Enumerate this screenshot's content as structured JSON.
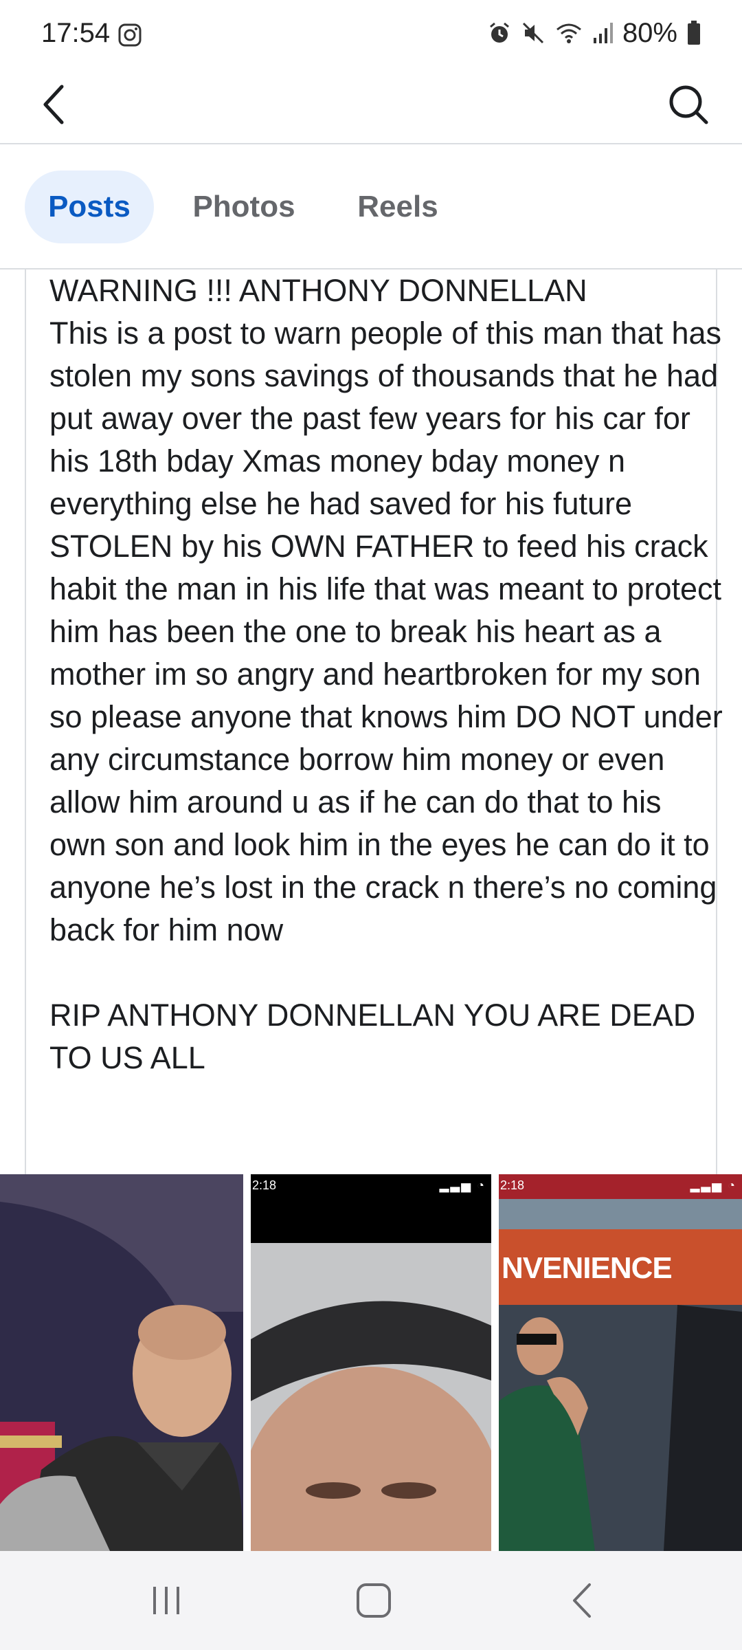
{
  "status_bar": {
    "time": "17:54",
    "battery": "80%",
    "icons": [
      "instagram-icon",
      "alarm-icon",
      "mute-icon",
      "wifi-icon",
      "signal-icon",
      "battery-icon"
    ]
  },
  "app_bar": {
    "back_icon": "back-arrow-icon",
    "search_icon": "search-icon"
  },
  "tabs": [
    {
      "label": "Posts",
      "active": true
    },
    {
      "label": "Photos",
      "active": false
    },
    {
      "label": "Reels",
      "active": false
    }
  ],
  "post": {
    "text": "WARNING !!! ANTHONY DONNELLAN\nThis is a post to warn people of this man that has stolen my sons savings of thousands that he had put away over the past few years for his car for his 18th bday Xmas money bday money n everything else he had saved for his future STOLEN by his OWN FATHER to feed his crack habit the man in his life that was meant to protect him has been the one to break his heart as a mother im so angry and heartbroken for my son so please anyone that knows him DO NOT under any circumstance borrow him money or even allow him around u as if he can do that to his own son and look him in the eyes he can do it to anyone he’s lost in the crack n there’s no coming back for him now\n\nRIP ANTHONY DONNELLAN YOU ARE DEAD TO US ALL",
    "photos": [
      {
        "mini_time": ""
      },
      {
        "mini_time": "2:18"
      },
      {
        "mini_time": "2:18",
        "sign_text": "NVENIENCE"
      }
    ]
  },
  "nav_bar": {
    "buttons": [
      "recents-icon",
      "home-icon",
      "back-icon"
    ]
  },
  "colors": {
    "accent": "#0a5ac2",
    "tab_active_bg": "#e7f0fd",
    "divider": "#dadde1",
    "nav_bg": "#f4f4f6"
  }
}
